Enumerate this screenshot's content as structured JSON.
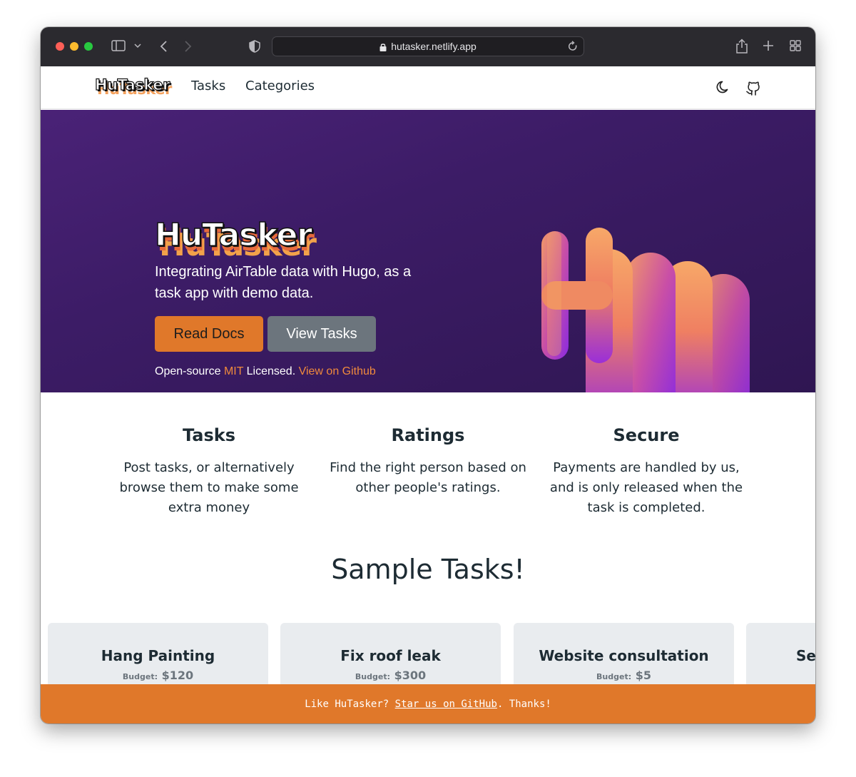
{
  "browser": {
    "url": "hutasker.netlify.app"
  },
  "nav": {
    "logo": "HuTasker",
    "links": [
      "Tasks",
      "Categories"
    ]
  },
  "hero": {
    "title": "HuTasker",
    "subtitle": "Integrating AirTable data with Hugo, as a task app with demo data.",
    "buttons": {
      "read_docs": "Read Docs",
      "view_tasks": "View Tasks"
    },
    "license_prefix": "Open-source ",
    "license_link": "MIT",
    "license_suffix": " Licensed. ",
    "github_link": "View on Github"
  },
  "features": [
    {
      "title": "Tasks",
      "text": "Post tasks, or alternatively browse them to make some extra money"
    },
    {
      "title": "Ratings",
      "text": "Find the right person based on other people's ratings."
    },
    {
      "title": "Secure",
      "text": "Payments are handled by us, and is only released when the task is completed."
    }
  ],
  "sample_title": "Sample Tasks!",
  "budget_label": "Budget:",
  "tasks": [
    {
      "title": "Hang Painting",
      "budget": "$120"
    },
    {
      "title": "Fix roof leak",
      "budget": "$300"
    },
    {
      "title": "Website consultation",
      "budget": "$5"
    },
    {
      "title": "Se"
    }
  ],
  "banner": {
    "prefix": "Like HuTasker? ",
    "link": "Star us on GitHub",
    "suffix": ". Thanks!"
  },
  "colors": {
    "accent": "#e0782a",
    "hero_bg": "#3c1c66",
    "secondary_button": "#6c757d",
    "card_bg": "#e9ecef"
  }
}
